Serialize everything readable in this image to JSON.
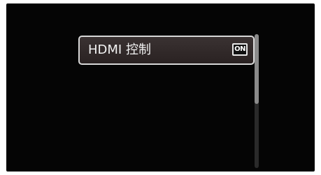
{
  "menu": {
    "items": [
      {
        "label": "HDMI 控制",
        "value_badge": "ON"
      }
    ]
  },
  "scrollbar": {
    "thumb_fraction": 0.52,
    "thumb_offset_fraction": 0.0
  },
  "colors": {
    "screen_background": "#050505",
    "item_background": "#2e2626",
    "item_border": "#d8d8d8",
    "text": "#f2f2f2",
    "scroll_thumb": "#8a8a8a",
    "scroll_track": "#2a2a2a"
  }
}
